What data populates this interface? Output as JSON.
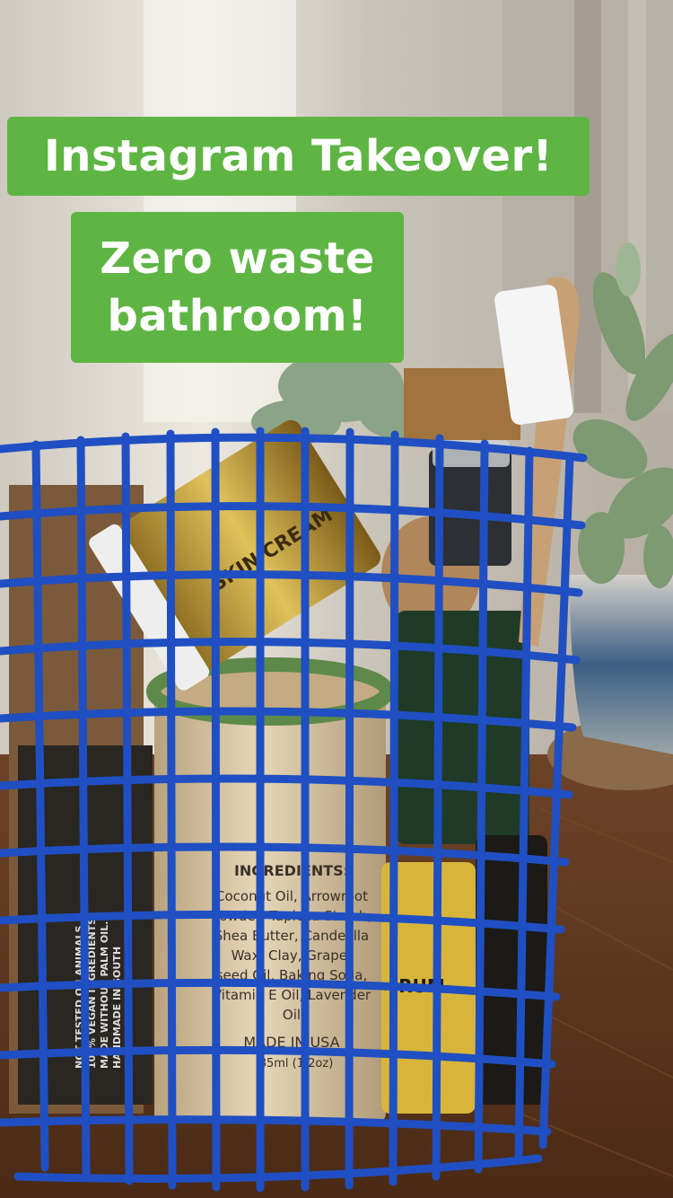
{
  "story": {
    "captions": {
      "title": "Instagram Takeover!",
      "subtitle_line1": "Zero waste",
      "subtitle_line2": "bathroom!"
    },
    "accent_color": "#5fb544",
    "text_color": "#ffffff"
  },
  "photo": {
    "basket_color": "#1f4fc2",
    "label_texts": {
      "jar_label": "SKIN CREAM",
      "tube_heading": "INGREDIENTS:",
      "tube_ingredients": [
        "Coconut Oil, Arrowroot",
        "Powder, Tapioca Starch,",
        "Shea Butter, Candelilla",
        "Wax, Clay, Grape-",
        "seed Oil, Baking Soda,",
        "Vitamin E Oil, Lavender",
        "Oil"
      ],
      "tube_made_in": "MADE IN USA",
      "tube_volume": "85ml (1.2oz)",
      "bottle_label": "RUM",
      "box_text": [
        "NOT TESTED ON ANIMALS.",
        "100% VEGAN INGREDIENTS.",
        "MADE WITHOUT PALM OIL.",
        "HANDMADE IN SOUTH"
      ]
    }
  }
}
